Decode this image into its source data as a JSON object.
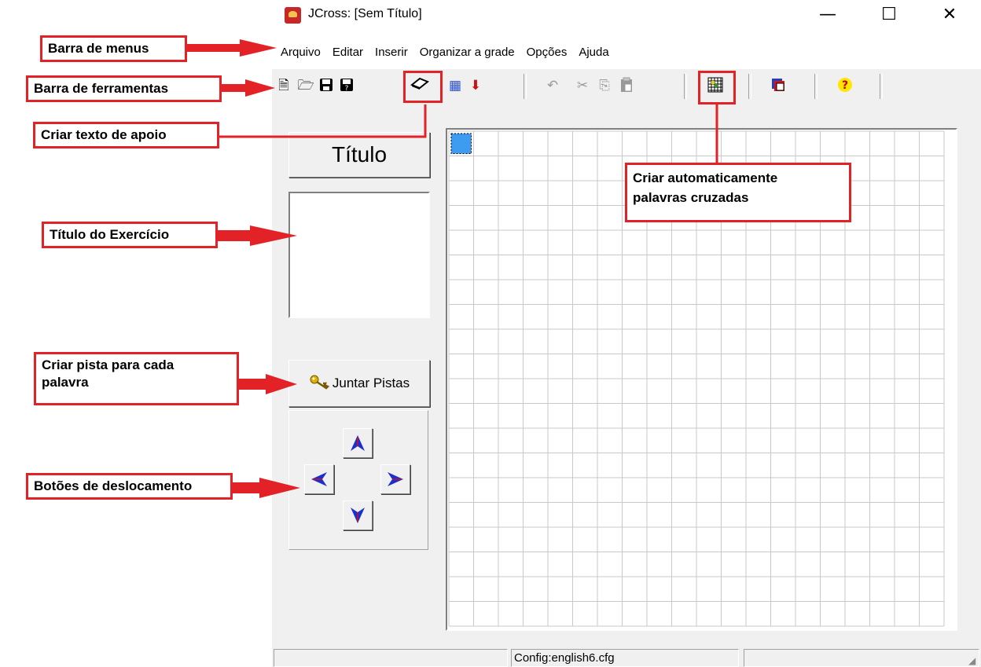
{
  "window": {
    "title": "JCross: [Sem Título]",
    "minimize_glyph": "—",
    "maximize_glyph": "☐",
    "close_glyph": "✕",
    "icon": "jcross-app-icon"
  },
  "menu": [
    "Arquivo",
    "Editar",
    "Inserir",
    "Organizar a grade",
    "Opções",
    "Ajuda"
  ],
  "toolbar": {
    "new": "🗎",
    "open": "🗁",
    "save": "💾",
    "save_as": "🖫",
    "reading_text": "◇",
    "web": "▦",
    "export": "⬇",
    "undo": "↶",
    "cut": "✂",
    "copy": "⎘",
    "paste": "📋",
    "auto_grid": "▦",
    "config": "◪",
    "help": "?"
  },
  "left_panel": {
    "title_button": "Título",
    "clues_button": "Juntar Pistas",
    "nav_up": "up-arrow",
    "nav_down": "down-arrow",
    "nav_left": "left-arrow",
    "nav_right": "right-arrow"
  },
  "grid": {
    "cols": 20,
    "rows": 20,
    "selected_cell_color": "#3d9bf0"
  },
  "status_bar": {
    "panel1": "",
    "panel2": "Config:english6.cfg",
    "panel3": ""
  },
  "annotations": {
    "menu_bar": "Barra de menus",
    "toolbar": "Barra de ferramentas",
    "reading_text": "Criar texto de apoio",
    "exercise_title": "Título do Exercício",
    "clue_line1": "Criar pista para cada",
    "clue_line2": "palavra",
    "nav_buttons": "Botões de deslocamento",
    "auto_line1": "Criar automaticamente",
    "auto_line2": "palavras cruzadas",
    "color": "#e32228"
  }
}
